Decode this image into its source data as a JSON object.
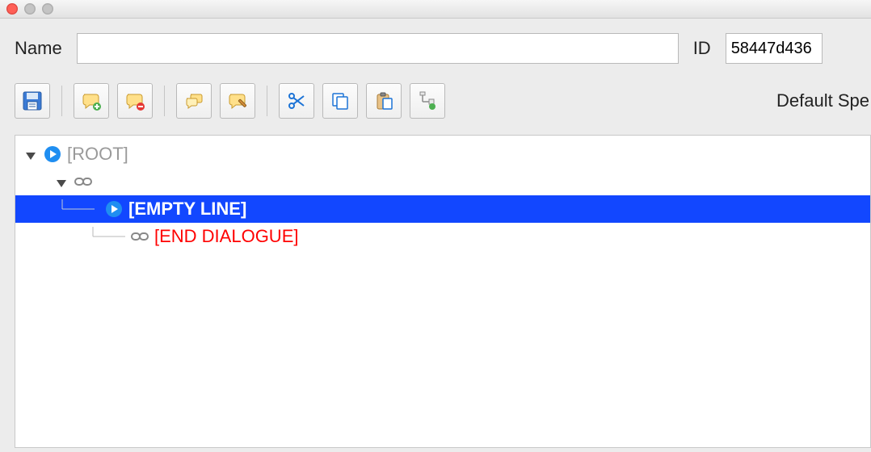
{
  "fields": {
    "name_label": "Name",
    "name_value": "",
    "id_label": "ID",
    "id_value": "58447d436"
  },
  "toolbar": {
    "right_label": "Default Spe"
  },
  "tree": {
    "root_label": "[ROOT]",
    "empty_line_label": "[EMPTY LINE]",
    "end_dialogue_label": "[END DIALOGUE]"
  }
}
